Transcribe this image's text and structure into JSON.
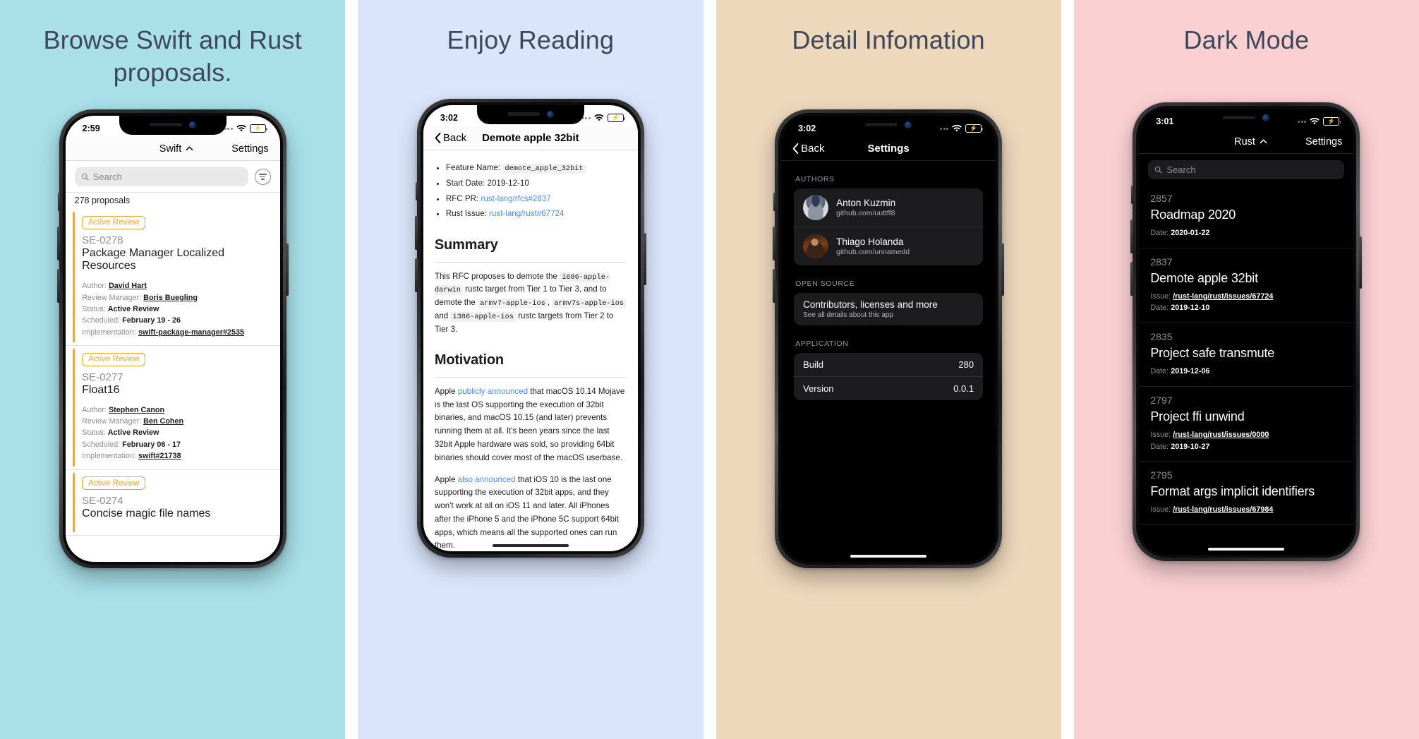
{
  "panels": [
    {
      "title": "Browse Swift and Rust proposals.",
      "bg": "#a8dfe8"
    },
    {
      "title": "Enjoy Reading",
      "bg": "#dae5fb"
    },
    {
      "title": "Detail Infomation",
      "bg": "#eed8bc"
    },
    {
      "title": "Dark Mode",
      "bg": "#fad0d3"
    }
  ],
  "colors": {
    "accent_orange": "#f5a623",
    "link_blue": "#4b8df8",
    "battery_green": "#34c759",
    "title_text": "#3d4759"
  },
  "p1": {
    "status_time": "2:59",
    "nav": {
      "language": "Swift",
      "settings": "Settings"
    },
    "search_placeholder": "Search",
    "count_label": "278 proposals",
    "cards": [
      {
        "badge": "Active Review",
        "id": "SE-0278",
        "title": "Package Manager Localized Resources",
        "meta": [
          {
            "label": "Author:",
            "value": "David Hart",
            "link": true
          },
          {
            "label": "Review Manager:",
            "value": "Boris Buegling",
            "link": true
          },
          {
            "label": "Status:",
            "value": "Active Review",
            "link": false
          },
          {
            "label": "Scheduled:",
            "value": "February 19 - 26",
            "link": false
          },
          {
            "label": "Implementation:",
            "value": "swift-package-manager#2535",
            "link": true
          }
        ]
      },
      {
        "badge": "Active Review",
        "id": "SE-0277",
        "title": "Float16",
        "meta": [
          {
            "label": "Author:",
            "value": "Stephen Canon",
            "link": true
          },
          {
            "label": "Review Manager:",
            "value": "Ben Cohen",
            "link": true
          },
          {
            "label": "Status:",
            "value": "Active Review",
            "link": false
          },
          {
            "label": "Scheduled:",
            "value": "February 06 - 17",
            "link": false
          },
          {
            "label": "Implementation:",
            "value": "swift#21738",
            "link": true
          }
        ]
      },
      {
        "badge": "Active Review",
        "id": "SE-0274",
        "title": "Concise magic file names",
        "meta": []
      }
    ]
  },
  "p2": {
    "status_time": "3:02",
    "nav": {
      "back": "Back",
      "title": "Demote apple 32bit"
    },
    "bullets": [
      {
        "label": "Feature Name: ",
        "code": "demote_apple_32bit"
      },
      {
        "label": "Start Date: 2019-12-10"
      },
      {
        "label": "RFC PR: ",
        "link": "rust-lang/rfcs#2837"
      },
      {
        "label": "Rust Issue: ",
        "link": "rust-lang/rust#67724"
      }
    ],
    "summary_heading": "Summary",
    "summary_parts": [
      "This RFC proposes to demote the ",
      "i686-apple-darwin",
      " rustc target from Tier 1 to Tier 3, and to demote the ",
      "armv7-apple-ios",
      ", ",
      "armv7s-apple-ios",
      " and ",
      "i386-apple-ios",
      " rustc targets from Tier 2 to Tier 3."
    ],
    "motivation_heading": "Motivation",
    "motivation_p1_a": "Apple ",
    "motivation_p1_link": "publicly announced",
    "motivation_p1_b": " that macOS 10.14 Mojave is the last OS supporting the execution of 32bit binaries, and macOS 10.15 (and later) prevents running them at all. It's been years since the last 32bit Apple hardware was sold, so providing 64bit binaries should cover most of the macOS userbase.",
    "motivation_p2_a": "Apple ",
    "motivation_p2_link": "also announced",
    "motivation_p2_b": " that iOS 10 is the last one supporting the execution of 32bit apps, and they won't work at all on iOS 11 and later. All iPhones after the iPhone 5 and the iPhone 5C support 64bit apps, which means all the supported ones can run them."
  },
  "p3": {
    "status_time": "3:02",
    "nav": {
      "back": "Back",
      "title": "Settings"
    },
    "sections": {
      "authors_header": "AUTHORS",
      "authors": [
        {
          "name": "Anton Kuzmin",
          "handle": "github.com/uuttff8"
        },
        {
          "name": "Thiago Holanda",
          "handle": "github.com/unnamedd"
        }
      ],
      "open_source_header": "OPEN SOURCE",
      "open_source_title": "Contributors, licenses and more",
      "open_source_sub": "See all details about this app",
      "application_header": "APPLICATION",
      "application_rows": [
        {
          "key": "Build",
          "value": "280"
        },
        {
          "key": "Version",
          "value": "0.0.1"
        }
      ]
    }
  },
  "p4": {
    "status_time": "3:01",
    "nav": {
      "language": "Rust",
      "settings": "Settings"
    },
    "search_placeholder": "Search",
    "rows": [
      {
        "id": "2857",
        "title": "Roadmap 2020",
        "issue": null,
        "date": "2020-01-22"
      },
      {
        "id": "2837",
        "title": "Demote apple 32bit",
        "issue": "/rust-lang/rust/issues/67724",
        "date": "2019-12-10"
      },
      {
        "id": "2835",
        "title": "Project safe transmute",
        "issue": null,
        "date": "2019-12-06"
      },
      {
        "id": "2797",
        "title": "Project ffi unwind",
        "issue": "/rust-lang/rust/issues/0000",
        "date": "2019-10-27"
      },
      {
        "id": "2795",
        "title": "Format args implicit identifiers",
        "issue": "/rust-lang/rust/issues/67984",
        "date": null
      }
    ],
    "labels": {
      "issue": "Issue:",
      "date": "Date:"
    }
  }
}
